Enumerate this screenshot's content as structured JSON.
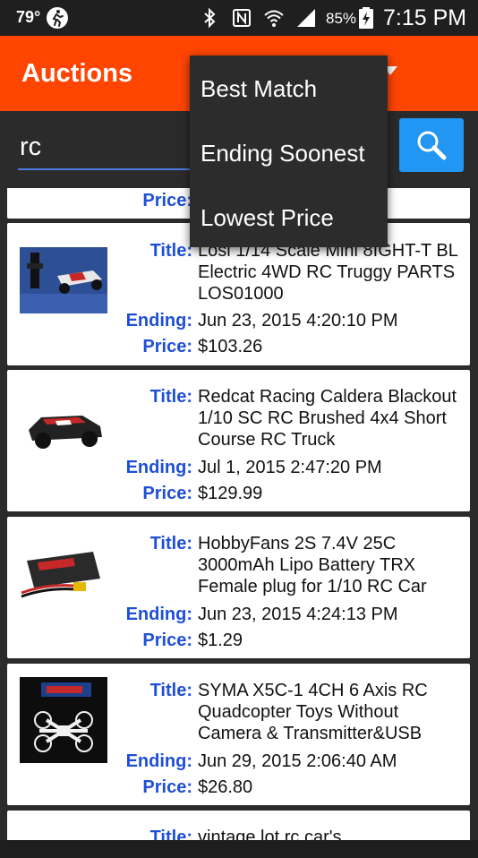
{
  "status_bar": {
    "temperature": "79°",
    "battery_percent": "85%",
    "time": "7:15 PM",
    "icons": [
      "runner-icon",
      "bluetooth-icon",
      "nfc-icon",
      "wifi-icon",
      "signal-icon",
      "battery-icon"
    ]
  },
  "app_bar": {
    "title": "Auctions",
    "accent_color": "#ff4500"
  },
  "search": {
    "query": "rc",
    "button_icon": "search-icon",
    "button_color": "#2196f3"
  },
  "labels": {
    "title": "Title:",
    "ending": "Ending:",
    "price": "Price:"
  },
  "listings": [
    {
      "title": "Losi 1/14 Scale Mini 8IGHT-T BL Electric 4WD RC Truggy PARTS LOS01000",
      "ending": "Jun 23, 2015 4:20:10 PM",
      "price": "$103.26"
    },
    {
      "title": "Redcat Racing Caldera Blackout 1/10 SC RC Brushed 4x4 Short Course RC Truck",
      "ending": "Jul 1, 2015 2:47:20 PM",
      "price": "$129.99"
    },
    {
      "title": "HobbyFans 2S 7.4V 25C 3000mAh Lipo Battery TRX Female plug for 1/10 RC Car",
      "ending": "Jun 23, 2015 4:24:13 PM",
      "price": "$1.29"
    },
    {
      "title": "SYMA X5C-1 4CH 6 Axis RC Quadcopter Toys Without Camera & Transmitter&USB",
      "ending": "Jun 29, 2015 2:06:40 AM",
      "price": "$26.80"
    },
    {
      "title": "vintage lot rc car's"
    }
  ],
  "sort_menu": {
    "options": [
      "Best Match",
      "Ending Soonest",
      "Lowest Price"
    ]
  }
}
